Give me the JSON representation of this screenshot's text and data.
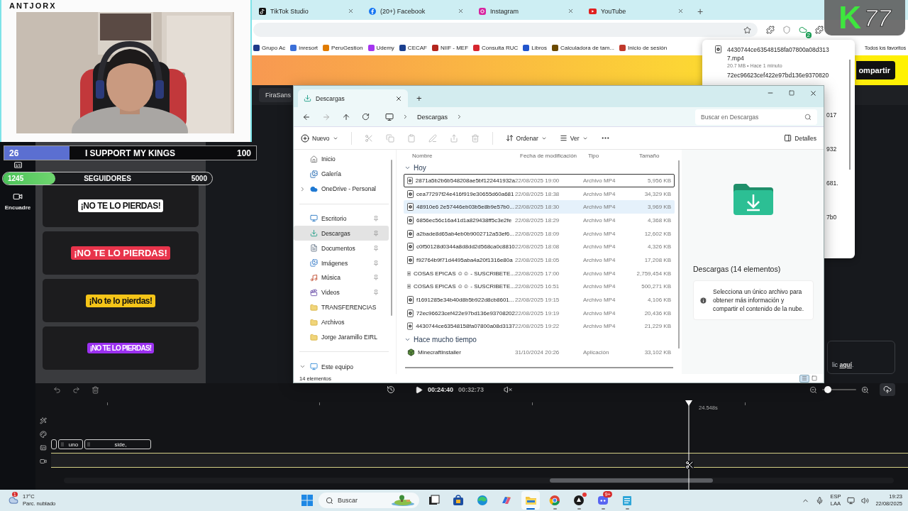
{
  "browser": {
    "tabs": [
      {
        "title": "TikTok Studio",
        "kind": "tiktok",
        "selected": false
      },
      {
        "title": "(20+) Facebook",
        "kind": "facebook",
        "selected": false
      },
      {
        "title": "Instagram",
        "kind": "instagram",
        "selected": false
      },
      {
        "title": "YouTube",
        "kind": "youtube",
        "selected": false
      }
    ],
    "new_tab": "+",
    "extension_badge": "2",
    "bookmarks": [
      {
        "label": "Grupo Ac",
        "color": "#1f3a8a"
      },
      {
        "label": "inresort",
        "color": "#3b6fd8"
      },
      {
        "label": "PeruGestion",
        "color": "#e07b00"
      },
      {
        "label": "Udemy",
        "color": "#a435f0"
      },
      {
        "label": "CECAF",
        "color": "#1b3f8f"
      },
      {
        "label": "NIIF - MEF",
        "color": "#b3261e"
      },
      {
        "label": "Consulta RUC",
        "color": "#d6262f"
      },
      {
        "label": "Libros",
        "color": "#2255cc"
      },
      {
        "label": "Calculadora de tam...",
        "color": "#6b4a00"
      },
      {
        "label": "Inicio de sesión",
        "color": "#c0392b"
      }
    ],
    "all_bookmarks": "Todos los favoritos",
    "banner_button": "ompartir"
  },
  "logo": {
    "letter": "K",
    "number": "77"
  },
  "downloads": {
    "items": [
      {
        "name": "4430744ce63548158fa07800a08d3137.mp4",
        "meta": "20.7 MB • Hace 1 minuto"
      },
      {
        "name": "72ec96623cef422e97bd136e9370820"
      }
    ],
    "fragments": [
      "017",
      "932",
      "681.",
      "7b0"
    ]
  },
  "webcam": {
    "channel": "ANTJORX"
  },
  "goals": [
    {
      "kind": "bar",
      "value": "26",
      "title": "I SUPPORT MY KINGS",
      "target": "100",
      "level": 0.26
    },
    {
      "kind": "pill",
      "value": "1245",
      "title": "SEGUIDORES",
      "target": "5000",
      "level": 0.25
    }
  ],
  "editor": {
    "rail": [
      {
        "kind": "captions"
      },
      {
        "kind": "frame",
        "label": "Encuadre"
      }
    ],
    "caption_styles": [
      {
        "text": "¡NO TE LO PIERDAS!",
        "color": "#ffffff",
        "kind": "bold"
      },
      {
        "text": "¡NO TE LO PIERDAS!",
        "color": "#e8344b",
        "kind": "wide"
      },
      {
        "text": "¡No te lo pierdas!",
        "color": "#f5c518",
        "kind": "bold"
      },
      {
        "text": "¡NO TE LO PIERDAS!",
        "color": "#9b30f0",
        "kind": "condensed"
      }
    ],
    "font_field": "FiraSans",
    "hint": {
      "text": "lic",
      "link": "aquí",
      "after": "."
    }
  },
  "timeline": {
    "current": "00:24:40",
    "total": "00:32:73",
    "zoom": {
      "level": 0.16
    },
    "playhead": "24.548s",
    "clips": [
      {
        "text": "uno"
      },
      {
        "text": "side,"
      }
    ]
  },
  "explorer": {
    "tab": "Descargas",
    "new_tab": "+",
    "path": [
      "Descargas"
    ],
    "search_placeholder": "Buscar en Descargas",
    "new": "Nuevo",
    "actions": [
      {
        "kind": "cut",
        "disabled": true
      },
      {
        "kind": "copy",
        "disabled": true
      },
      {
        "kind": "paste",
        "disabled": true
      },
      {
        "kind": "rename",
        "disabled": true
      },
      {
        "kind": "share",
        "disabled": true
      },
      {
        "kind": "delete",
        "disabled": true
      }
    ],
    "sort": "Ordenar",
    "view": "Ver",
    "details_button": "Detalles",
    "nav": [
      {
        "items": [
          {
            "label": "Inicio",
            "kind": "home",
            "pinned": false,
            "selected": false
          },
          {
            "label": "Galería",
            "kind": "gallery",
            "pinned": false,
            "selected": false
          },
          {
            "label": "OneDrive - Personal",
            "kind": "cloud",
            "expanded": false,
            "pinned": false,
            "selected": false
          }
        ]
      },
      {
        "items": [
          {
            "label": "Escritorio",
            "kind": "desktop",
            "pinned": true,
            "selected": false
          },
          {
            "label": "Descargas",
            "kind": "download",
            "pinned": true,
            "selected": true
          },
          {
            "label": "Documentos",
            "kind": "documents",
            "pinned": true,
            "selected": false
          },
          {
            "label": "Imágenes",
            "kind": "pictures",
            "pinned": true,
            "selected": false
          },
          {
            "label": "Música",
            "kind": "music",
            "pinned": true,
            "selected": false
          },
          {
            "label": "Videos",
            "kind": "videos",
            "pinned": true,
            "selected": false
          },
          {
            "label": "TRANSFERENCIAS",
            "kind": "folder",
            "pinned": false,
            "selected": false
          },
          {
            "label": "Archivos",
            "kind": "folder",
            "pinned": false,
            "selected": false
          },
          {
            "label": "Jorge Jaramillo EIRL",
            "kind": "folder",
            "pinned": false,
            "selected": false
          }
        ]
      },
      {
        "items": [
          {
            "label": "Este equipo",
            "kind": "pc",
            "expanded": true,
            "pinned": false,
            "selected": false
          }
        ]
      }
    ],
    "columns": [
      "Nombre",
      "Fecha de modificación",
      "Tipo",
      "Tamaño"
    ],
    "groups": [
      {
        "title": "Hoy",
        "expanded": true,
        "rows": [
          {
            "name": "2871a5b2b6b548208ae5bf122441932a",
            "date": "22/08/2025 19:00",
            "type": "Archivo MP4",
            "size": "5,956 KB",
            "kind": "video",
            "focused": true,
            "hovered": false
          },
          {
            "name": "cea77297f24e416f919e30655d60a681",
            "date": "22/08/2025 18:38",
            "type": "Archivo MP4",
            "size": "34,329 KB",
            "kind": "video",
            "focused": false,
            "hovered": false
          },
          {
            "name": "48910e6 2e57446eb03b5e8b9e57b0...",
            "date": "22/08/2025 18:30",
            "type": "Archivo MP4",
            "size": "3,969 KB",
            "kind": "video",
            "focused": false,
            "hovered": true
          },
          {
            "name": "6856ec56c16a41d1a829438ff5c3e2fe",
            "date": "22/08/2025 18:29",
            "type": "Archivo MP4",
            "size": "4,368 KB",
            "kind": "video",
            "focused": false,
            "hovered": false
          },
          {
            "name": "a2bade8d65ab4eb0b9002712a53ef6...",
            "date": "22/08/2025 18:09",
            "type": "Archivo MP4",
            "size": "12,602 KB",
            "kind": "video",
            "focused": false,
            "hovered": false
          },
          {
            "name": "c0f50128d0344a8d8dd2d568ca0c8810",
            "date": "22/08/2025 18:08",
            "type": "Archivo MP4",
            "size": "4,326 KB",
            "kind": "video",
            "focused": false,
            "hovered": false
          },
          {
            "name": "f92764b9f71d4495aba4a20f1316e80a",
            "date": "22/08/2025 18:05",
            "type": "Archivo MP4",
            "size": "17,208 KB",
            "kind": "video",
            "focused": false,
            "hovered": false
          },
          {
            "name": "COSAS EPICAS ☺☺ - SUSCRIBETE...",
            "date": "22/08/2025 17:00",
            "type": "Archivo MP4",
            "size": "2,759,454 KB",
            "kind": "video",
            "focused": false,
            "hovered": false
          },
          {
            "name": "COSAS EPICAS ☺☺ - SUSCRIBETE...",
            "date": "22/08/2025 16:51",
            "type": "Archivo MP4",
            "size": "500,271 KB",
            "kind": "video",
            "focused": false,
            "hovered": false
          },
          {
            "name": "f1691285e34b40d8b5b922d8cb8601...",
            "date": "22/08/2025 19:15",
            "type": "Archivo MP4",
            "size": "4,106 KB",
            "kind": "video",
            "focused": false,
            "hovered": false
          },
          {
            "name": "72ec96623cef422e97bd136e93708202",
            "date": "22/08/2025 19:19",
            "type": "Archivo MP4",
            "size": "20,436 KB",
            "kind": "video",
            "focused": false,
            "hovered": false
          },
          {
            "name": "4430744ce63548158fa07800a08d3137",
            "date": "22/08/2025 19:22",
            "type": "Archivo MP4",
            "size": "21,229 KB",
            "kind": "video",
            "focused": false,
            "hovered": false
          }
        ]
      },
      {
        "title": "Hace mucho tiempo",
        "expanded": true,
        "rows": [
          {
            "name": "MinecraftInstaller",
            "date": "31/10/2024 20:26",
            "type": "Aplicación",
            "size": "33,102 KB",
            "kind": "app",
            "focused": false,
            "hovered": false
          }
        ]
      }
    ],
    "details": {
      "title": "Descargas (14 elementos)",
      "info": "Selecciona un único archivo para obtener más información y compartir el contenido de la nube."
    },
    "status": "14 elementos",
    "views": [
      {
        "kind": "details",
        "selected": true
      },
      {
        "kind": "tiles",
        "selected": false
      }
    ]
  },
  "taskbar": {
    "weather": {
      "temp": "17°C",
      "desc": "Parc. nublado",
      "badge": "1"
    },
    "search": "Buscar",
    "apps": [
      {
        "kind": "taskview",
        "running": false,
        "active": false,
        "notification": false
      },
      {
        "kind": "store",
        "running": false,
        "active": false,
        "notification": false
      },
      {
        "kind": "edge",
        "running": false,
        "active": false,
        "notification": false
      },
      {
        "kind": "copilot",
        "running": false,
        "active": false,
        "notification": false
      },
      {
        "kind": "explorer",
        "running": true,
        "active": true,
        "notification": false
      },
      {
        "kind": "chrome",
        "running": true,
        "active": false,
        "notification": false
      },
      {
        "kind": "app",
        "running": true,
        "active": false,
        "notification": true
      },
      {
        "kind": "discord",
        "running": true,
        "active": false,
        "notification": false,
        "badge": "9+"
      },
      {
        "kind": "notepad",
        "running": true,
        "active": false,
        "notification": false
      }
    ],
    "tray": {
      "lang": "ESP",
      "layout": "LAA",
      "time": "19:23",
      "date": "22/08/2025"
    }
  }
}
